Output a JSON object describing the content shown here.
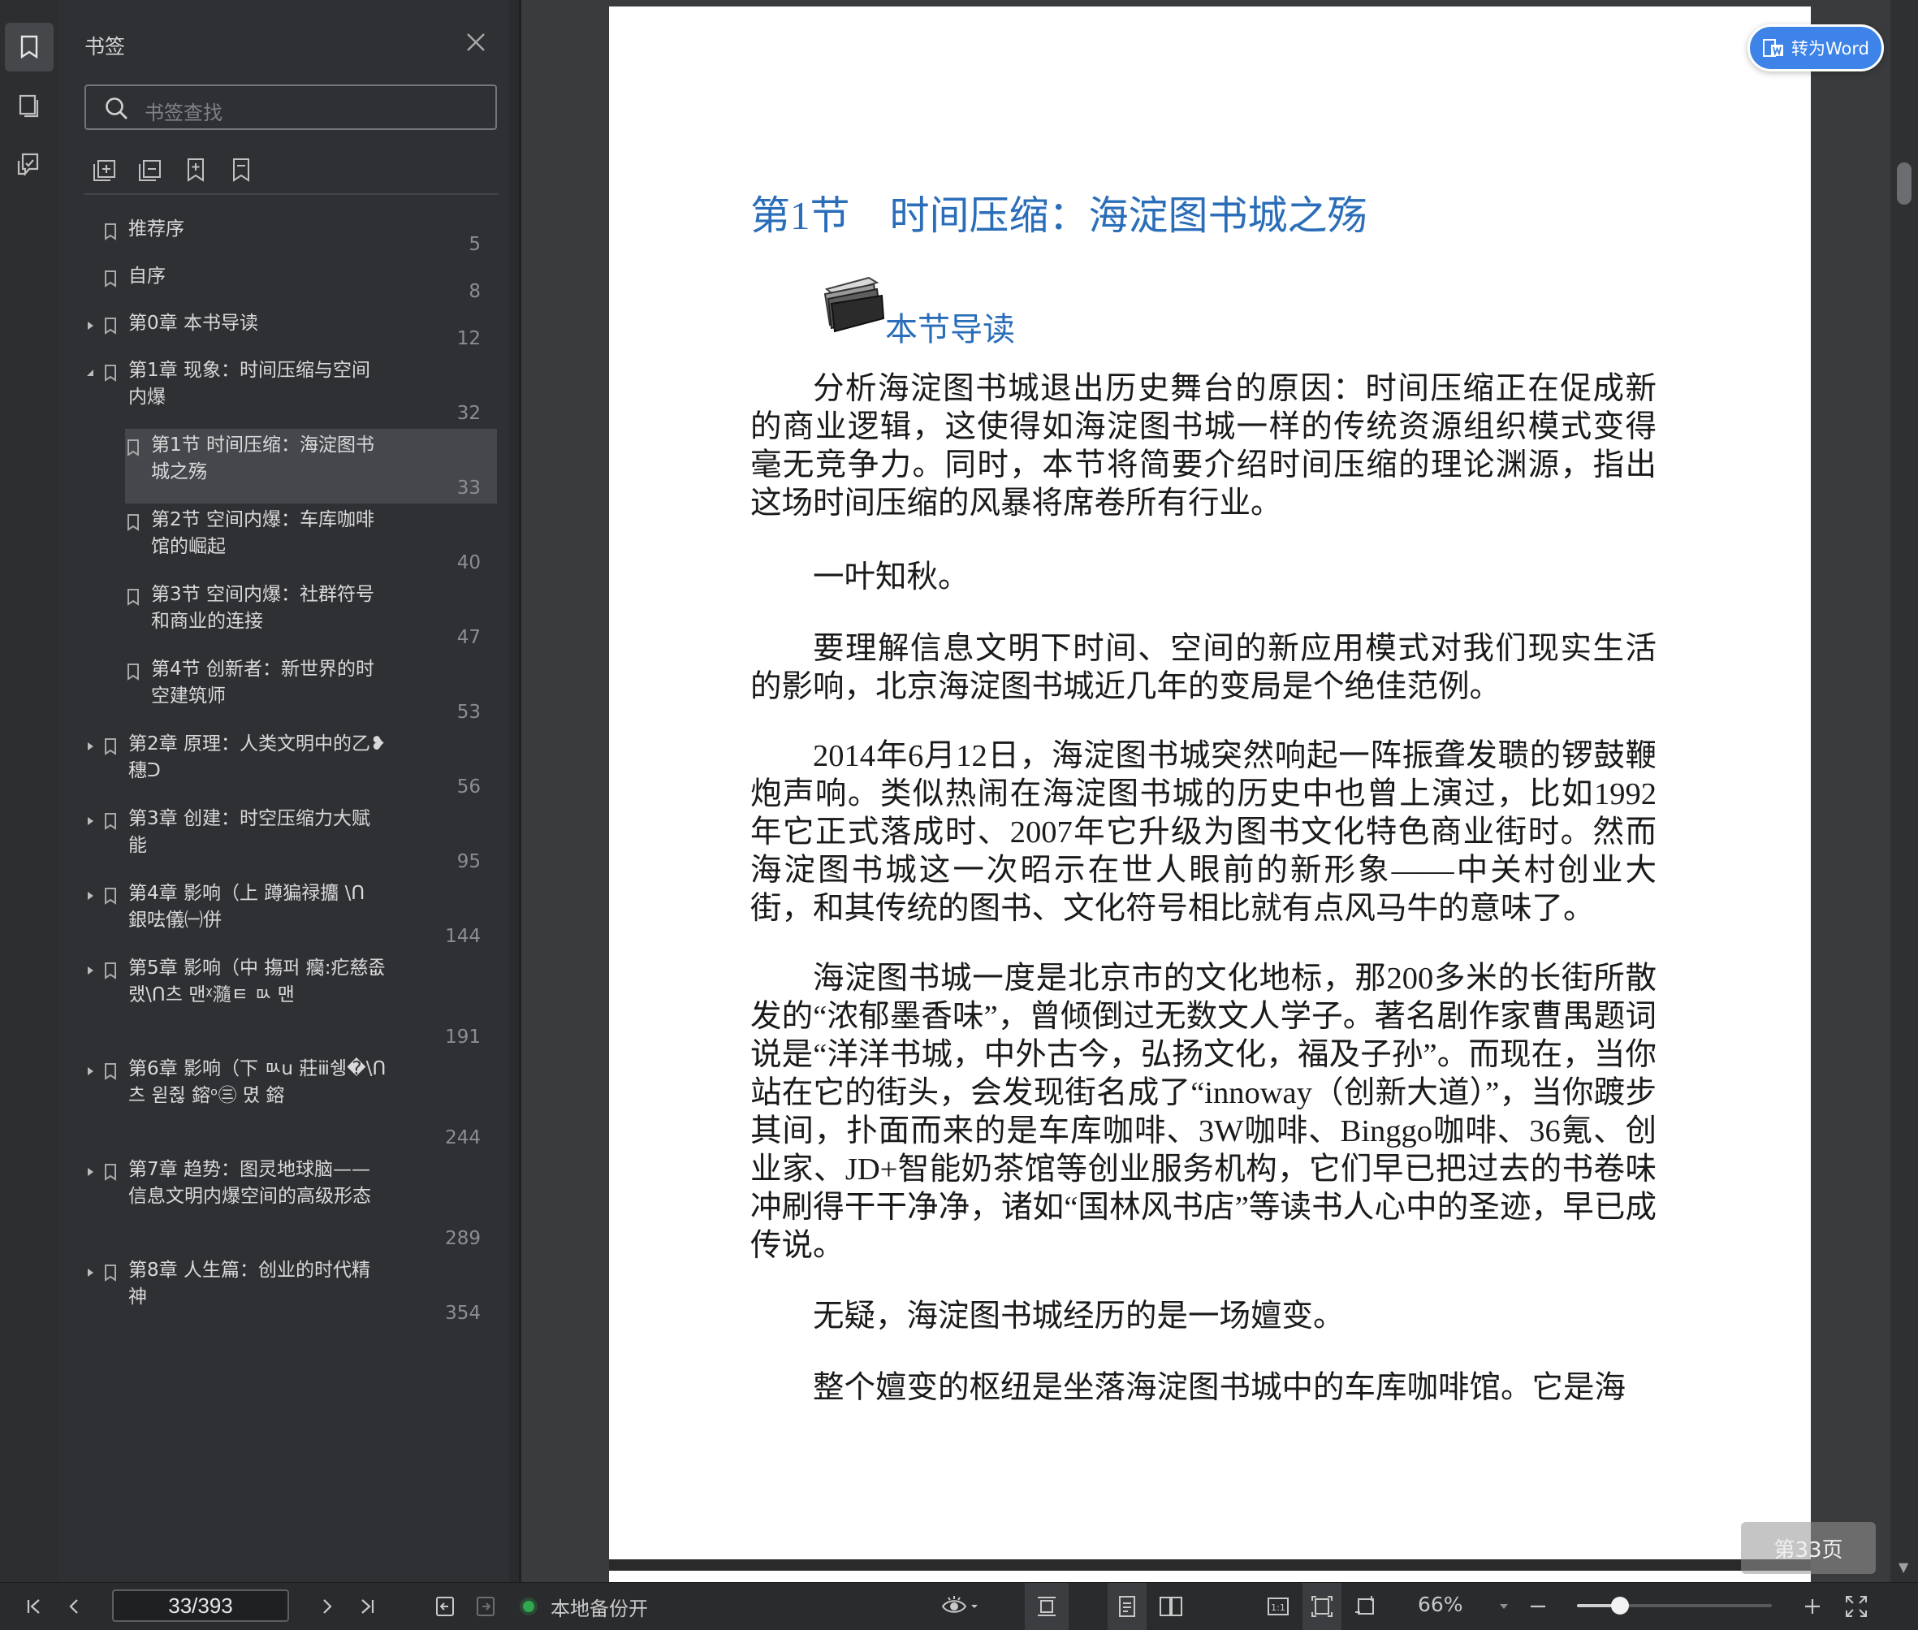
{
  "sidebar": {
    "title": "书签",
    "search_placeholder": "书签查找",
    "tools": [
      "expand-all-icon",
      "collapse-all-icon",
      "add-bookmark-icon",
      "bookmark-outline-icon"
    ],
    "items": [
      {
        "label": "推荐序",
        "page": "5",
        "level": 0,
        "expandable": false
      },
      {
        "label": "自序",
        "page": "8",
        "level": 0,
        "expandable": false
      },
      {
        "label": "第0章 本书导读",
        "page": "12",
        "level": 0,
        "expandable": true,
        "expanded": false
      },
      {
        "label": "第1章 现象：时间压缩与空间内爆",
        "page": "32",
        "level": 0,
        "expandable": true,
        "expanded": true
      },
      {
        "label": "第1节 时间压缩：海淀图书城之殇",
        "page": "33",
        "level": 1,
        "expandable": false,
        "selected": true
      },
      {
        "label": "第2节 空间内爆：车库咖啡馆的崛起",
        "page": "40",
        "level": 1,
        "expandable": false
      },
      {
        "label": "第3节 空间内爆：社群符号和商业的连接",
        "page": "47",
        "level": 1,
        "expandable": false
      },
      {
        "label": "第4节 创新者：新世界的时空建筑师",
        "page": "53",
        "level": 1,
        "expandable": false
      },
      {
        "label": "第2章 原理：人类文明中的乙❥穗ᑐ",
        "page": "56",
        "level": 0,
        "expandable": true,
        "expanded": false
      },
      {
        "label": "第3章 创建：时空压缩力大赋能",
        "page": "95",
        "level": 0,
        "expandable": true,
        "expanded": false
      },
      {
        "label": "第4章 影响（上 蹲猵禄攟 \\ᑎ 銀呿儀㈠併",
        "page": "144",
        "level": 0,
        "expandable": true,
        "expanded": false
      },
      {
        "label": "第5章 影响（中 摥퍼 癵:疕慈좂랬\\ᑎ츠 맨ᵡ瀡ㅌ ㅯ 맨",
        "page": "191",
        "level": 0,
        "expandable": true,
        "expanded": false
      },
      {
        "label": "第6章 影响（下 ㅯu 莊ⅲ쉥�\\ᑎ츠 윋쥖 鎔ᵒ㊂ 몄 鎔",
        "page": "244",
        "level": 0,
        "expandable": true,
        "expanded": false
      },
      {
        "label": "第7章 趋势：图灵地球脑——信息文明内爆空间的高级形态",
        "page": "289",
        "level": 0,
        "expandable": true,
        "expanded": false
      },
      {
        "label": "第8章 人生篇：创业的时代精神",
        "page": "354",
        "level": 0,
        "expandable": true,
        "expanded": false
      }
    ]
  },
  "document": {
    "section_title": "第1节　时间压缩：海淀图书城之殇",
    "guide_label": "本节导读",
    "paragraphs": [
      "分析海淀图书城退出历史舞台的原因：时间压缩正在促成新的商业逻辑，这使得如海淀图书城一样的传统资源组织模式变得毫无竞争力。同时，本节将简要介绍时间压缩的理论渊源，指出这场时间压缩的风暴将席卷所有行业。",
      "一叶知秋。",
      "要理解信息文明下时间、空间的新应用模式对我们现实生活的影响，北京海淀图书城近几年的变局是个绝佳范例。",
      "2014年6月12日，海淀图书城突然响起一阵振聋发聩的锣鼓鞭炮声响。类似热闹在海淀图书城的历史中也曾上演过，比如1992年它正式落成时、2007年它升级为图书文化特色商业街时。然而海淀图书城这一次昭示在世人眼前的新形象——中关村创业大街，和其传统的图书、文化符号相比就有点风马牛的意味了。",
      "海淀图书城一度是北京市的文化地标，那200多米的长街所散发的“浓郁墨香味”，曾倾倒过无数文人学子。著名剧作家曹禺题词说是“洋洋书城，中外古今，弘扬文化，福及子孙”。而现在，当你站在它的街头，会发现街名成了“innoway（创新大道）”，当你踱步其间，扑面而来的是车库咖啡、3W咖啡、Binggo咖啡、36氪、创业家、JD+智能奶茶馆等创业服务机构，它们早已把过去的书卷味冲刷得干干净净，诸如“国林风书店”等读书人心中的圣迹，早已成传说。",
      "无疑，海淀图书城经历的是一场嬗变。",
      "整个嬗变的枢纽是坐落海淀图书城中的车库咖啡馆。它是海"
    ],
    "convert_button": "转为Word",
    "page_indicator": "第33页"
  },
  "statusbar": {
    "page_input": "33/393",
    "backup_status": "本地备份开",
    "zoom": "66%",
    "zoom_fraction": 0.22
  },
  "colors": {
    "accent_blue": "#2a6db8",
    "button_blue": "#3d83e8",
    "backup_green": "#2fa84f"
  }
}
